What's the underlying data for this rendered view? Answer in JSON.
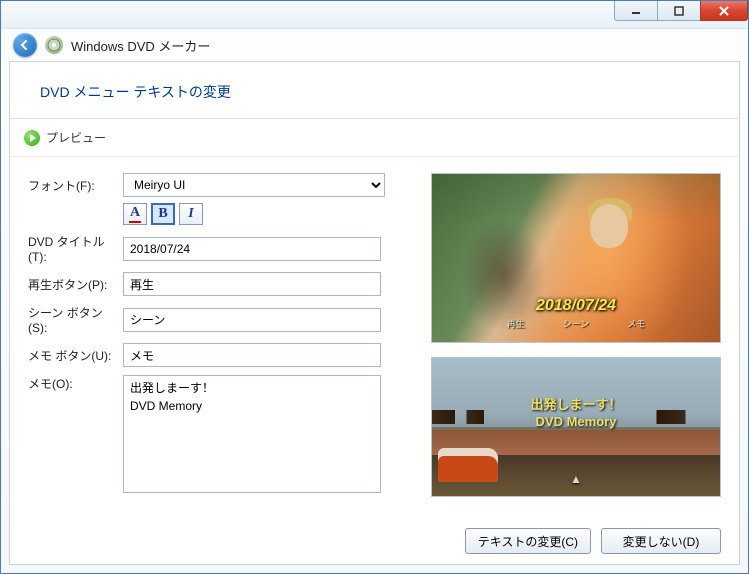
{
  "app_title": "Windows DVD メーカー",
  "page_heading": "DVD メニュー テキストの変更",
  "preview_link": "プレビュー",
  "labels": {
    "font": "フォント(F):",
    "dvd_title": "DVD タイトル(T):",
    "play_button": "再生ボタン(P):",
    "scene_button": "シーン ボタン(S):",
    "notes_button": "メモ ボタン(U):",
    "notes": "メモ(O):"
  },
  "fields": {
    "font": "Meiryo UI",
    "dvd_title": "2018/07/24",
    "play_button": "再生",
    "scene_button": "シーン",
    "notes_button": "メモ",
    "notes": "出発しまーす！\nDVD Memory"
  },
  "format": {
    "color_tip": "A",
    "bold_tip": "B",
    "italic_tip": "I",
    "bold_selected": true
  },
  "preview1": {
    "date": "2018/07/24",
    "menu_play": "再生",
    "menu_scene": "シーン",
    "menu_notes": "メモ"
  },
  "preview2": {
    "line1": "出発しまーす！",
    "line2": "DVD Memory",
    "arrow": "▲"
  },
  "buttons": {
    "change": "テキストの変更(C)",
    "skip": "変更しない(D)"
  }
}
